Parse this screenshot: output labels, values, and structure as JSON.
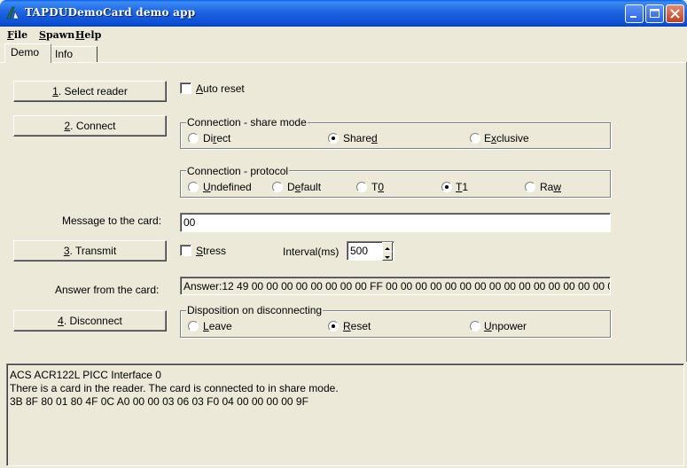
{
  "window": {
    "title": "TAPDUDemoCard demo app"
  },
  "menu": [
    {
      "label": "File",
      "key": "F",
      "rest": "ile"
    },
    {
      "label": "Spawn",
      "key": "S",
      "rest": "pawn"
    },
    {
      "label": "Help",
      "key": "H",
      "rest": "elp"
    }
  ],
  "tabs": {
    "demo": "Demo",
    "info": "Info"
  },
  "buttons": {
    "select_reader": {
      "key": "1",
      "rest": ". Select reader"
    },
    "connect": {
      "key": "2",
      "rest": ". Connect"
    },
    "transmit": {
      "key": "3",
      "rest": ". Transmit"
    },
    "disconnect": {
      "key": "4",
      "rest": ". Disconnect"
    }
  },
  "auto_reset": {
    "key": "A",
    "rest": "uto reset",
    "checked": false
  },
  "share_mode": {
    "title": "Connection - share mode",
    "options": [
      {
        "pre": "Di",
        "key": "r",
        "post": "ect",
        "selected": false
      },
      {
        "pre": "Share",
        "key": "d",
        "post": "",
        "selected": true
      },
      {
        "pre": "E",
        "key": "x",
        "post": "clusive",
        "selected": false
      }
    ]
  },
  "protocol": {
    "title": "Connection - protocol",
    "options": [
      {
        "pre": "",
        "key": "U",
        "post": "ndefined",
        "selected": false
      },
      {
        "pre": "D",
        "key": "e",
        "post": "fault",
        "selected": false
      },
      {
        "pre": "T",
        "key": "0",
        "post": "",
        "selected": false
      },
      {
        "pre": "",
        "key": "T",
        "post": "1",
        "selected": true
      },
      {
        "pre": "Ra",
        "key": "w",
        "post": "",
        "selected": false
      }
    ]
  },
  "message": {
    "label": "Message to the card:",
    "value": "00"
  },
  "stress": {
    "key": "S",
    "rest": "tress",
    "checked": false
  },
  "interval": {
    "label": "Interval(ms)",
    "value": "500"
  },
  "answer": {
    "label": "Answer from the card:",
    "value": "Answer:12 49 00 00 00 00 00 00 00 00 FF 00 00 00 00 00 00 00 00 00 00 00 00 00 00 00 00"
  },
  "disposition": {
    "title": "Disposition on disconnecting",
    "options": [
      {
        "pre": "",
        "key": "L",
        "post": "eave",
        "selected": false
      },
      {
        "pre": "",
        "key": "R",
        "post": "eset",
        "selected": true
      },
      {
        "pre": "",
        "key": "U",
        "post": "npower",
        "selected": false
      }
    ]
  },
  "log": {
    "lines": [
      "ACS ACR122L PICC Interface 0",
      "There is a card in the reader. The card is connected to in share mode.",
      "3B 8F 80 01 80 4F 0C A0 00 00 03 06 03 F0 04 00 00 00 00 9F"
    ]
  }
}
